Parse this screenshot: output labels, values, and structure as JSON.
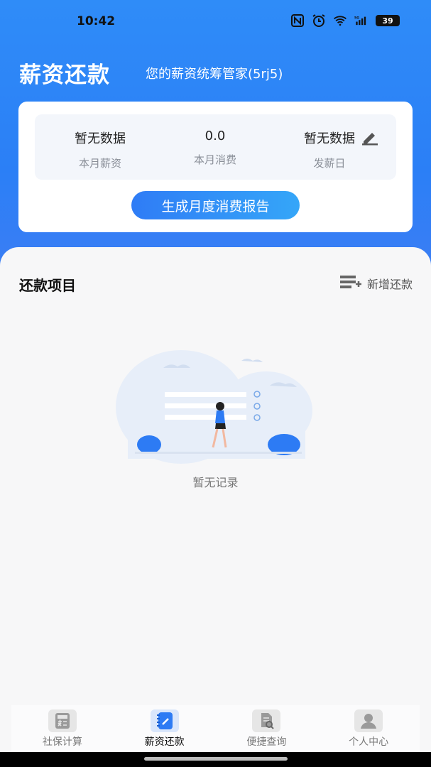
{
  "status_bar": {
    "time": "10:42",
    "battery": "39"
  },
  "header": {
    "title": "薪资还款",
    "subtitle": "您的薪资统筹管家(5rj5)"
  },
  "summary": {
    "stats": [
      {
        "value": "暂无数据",
        "label": "本月薪资"
      },
      {
        "value": "0.0",
        "label": "本月消费"
      },
      {
        "value": "暂无数据",
        "label": "发薪日"
      }
    ],
    "report_button": "生成月度消费报告"
  },
  "repayment": {
    "section_title": "还款项目",
    "add_label": "新增还款",
    "empty_text": "暂无记录"
  },
  "tabbar": {
    "items": [
      {
        "label": "社保计算",
        "icon": "calculator-icon"
      },
      {
        "label": "薪资还款",
        "icon": "notebook-icon",
        "active": true
      },
      {
        "label": "便捷查询",
        "icon": "document-search-icon"
      },
      {
        "label": "个人中心",
        "icon": "user-icon"
      }
    ]
  },
  "colors": {
    "primary": "#2f8cf8",
    "accent": "#2b7ff6",
    "text_muted": "#8a8f98"
  }
}
